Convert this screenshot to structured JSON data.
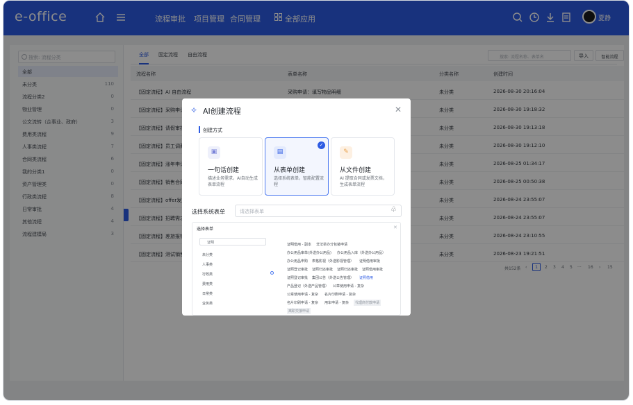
{
  "app": {
    "brand": "e-office",
    "user_name": "夏静"
  },
  "top_nav": [
    {
      "label": "流程审批"
    },
    {
      "label": "项目管理"
    },
    {
      "label": "合同管理"
    },
    {
      "label": "全部应用"
    }
  ],
  "sidebar": {
    "search_placeholder": "搜索: 流程分类",
    "items": [
      {
        "label": "全部",
        "count": ""
      },
      {
        "label": "未分类",
        "count": "110"
      },
      {
        "label": "流程分类2",
        "count": "0"
      },
      {
        "label": "物业管理",
        "count": "0"
      },
      {
        "label": "公文流转（企事业、政府）",
        "count": "3"
      },
      {
        "label": "费用类流程",
        "count": "9"
      },
      {
        "label": "人事类流程",
        "count": "7"
      },
      {
        "label": "合同类流程",
        "count": "6"
      },
      {
        "label": "我的分类1",
        "count": "0"
      },
      {
        "label": "资产管理类",
        "count": "0"
      },
      {
        "label": "行政类流程",
        "count": "8"
      },
      {
        "label": "日常审批",
        "count": "4"
      },
      {
        "label": "其他流程",
        "count": "4"
      },
      {
        "label": "流程建模局",
        "count": "3"
      }
    ]
  },
  "tabs": [
    {
      "label": "全部"
    },
    {
      "label": "固定流程"
    },
    {
      "label": "自由流程"
    }
  ],
  "toolbar": {
    "search_placeholder": "搜索: 流程名称、表单名",
    "import_label": "导入",
    "ai_label": "智能流程"
  },
  "table": {
    "headers": [
      "流程名称",
      "表单名称",
      "分类名称",
      "创建时间"
    ],
    "rows": [
      {
        "name": "【固定流程】AI 自由流程",
        "form": "采购申请：填写物品明细",
        "category": "未分类",
        "time": "2026-08-30 20:16:04"
      },
      {
        "name": "【固定流程】采购申请",
        "form": "",
        "category": "未分类",
        "time": "2026-08-30 19:18:32"
      },
      {
        "name": "【固定流程】请假审批",
        "form": "",
        "category": "未分类",
        "time": "2026-08-30 19:13:18"
      },
      {
        "name": "【固定流程】员工调薪",
        "form": "",
        "category": "未分类",
        "time": "2026-08-30 19:12:10"
      },
      {
        "name": "【固定流程】涨年申请",
        "form": "",
        "category": "未分类",
        "time": "2026-08-25 01:34:17"
      },
      {
        "name": "【固定流程】销售合同",
        "form": "",
        "category": "未分类",
        "time": "2026-08-25 00:50:38"
      },
      {
        "name": "【固定流程】offer发放",
        "form": "",
        "category": "未分类",
        "time": "2026-08-24 23:55:07"
      },
      {
        "name": "【固定流程】招聘需求",
        "form": "",
        "category": "未分类",
        "time": "2026-08-24 23:55:07"
      },
      {
        "name": "【固定流程】差旅报销",
        "form": "",
        "category": "未分类",
        "time": "2026-08-24 23:10:55"
      },
      {
        "name": "【固定流程】测试销售",
        "form": "",
        "category": "未分类",
        "time": "2026-08-23 19:21:51"
      }
    ]
  },
  "pagination": {
    "total": "共152条",
    "current": "1",
    "pages": [
      "2",
      "3",
      "4",
      "5",
      "···",
      "16"
    ],
    "size": "15"
  },
  "modal": {
    "title": "AI创建流程",
    "section_title": "创建方式",
    "cards": [
      {
        "title": "一句话创建",
        "desc": "描述业务需求，AI自动生成表单流程",
        "icon": "image-icon"
      },
      {
        "title": "从表单创建",
        "desc": "选择系统表单，智能配置流程",
        "icon": "form-icon"
      },
      {
        "title": "从文件创建",
        "desc": "AI 提取合同或发票文档，生成表单流程",
        "icon": "clip-icon"
      }
    ],
    "field_label": "选择系统表单",
    "field_placeholder": "请选择表单",
    "picker": {
      "title": "选择表单",
      "search_value": "证明",
      "categories": [
        "未分类",
        "人事类",
        "行政类",
        "费用类",
        "日常类",
        "业务类"
      ],
      "forms": [
        "证明借用 - 副本",
        "非法举办分包装申请",
        "办公用品审单(外送办公用品)",
        "办公用品入库（外送办公用品）",
        "办公用品申购",
        "表格影视（外送影视管理）",
        "证明借用审批",
        "证照登记审批",
        "证照归还审批",
        "证照归还审批",
        "证照借用审批",
        "证照登记审批",
        "集团公告（外送公告管理）",
        "证照借用",
        "产品登记（外送产品管理）",
        "公章使用申请 - 复杂",
        "公章使用申请 - 复杂",
        "名片印刷申请 - 复杂",
        "名片印刷申请 - 复杂",
        "用车申请 - 复杂",
        "代理商付款申请",
        "离职交接申请"
      ]
    }
  },
  "colors": {
    "brand_blue": "#2d5be3"
  }
}
